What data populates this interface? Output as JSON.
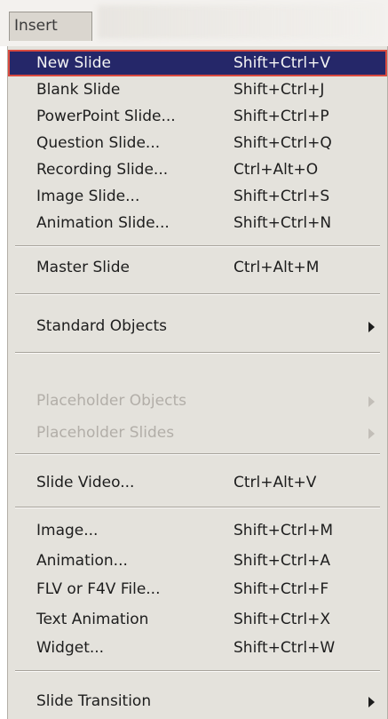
{
  "menubar": {
    "insert_label": "Insert"
  },
  "menu": {
    "items": [
      {
        "label": "New Slide",
        "shortcut": "Shift+Ctrl+V"
      },
      {
        "label": "Blank Slide",
        "shortcut": "Shift+Ctrl+J"
      },
      {
        "label": "PowerPoint Slide...",
        "shortcut": "Shift+Ctrl+P"
      },
      {
        "label": "Question Slide...",
        "shortcut": "Shift+Ctrl+Q"
      },
      {
        "label": "Recording Slide...",
        "shortcut": "Ctrl+Alt+O"
      },
      {
        "label": "Image Slide...",
        "shortcut": "Shift+Ctrl+S"
      },
      {
        "label": "Animation Slide...",
        "shortcut": "Shift+Ctrl+N"
      },
      {
        "label": "Master Slide",
        "shortcut": "Ctrl+Alt+M"
      },
      {
        "label": "Standard Objects",
        "shortcut": ""
      },
      {
        "label": "Placeholder Objects",
        "shortcut": ""
      },
      {
        "label": "Placeholder Slides",
        "shortcut": ""
      },
      {
        "label": "Slide Video...",
        "shortcut": "Ctrl+Alt+V"
      },
      {
        "label": "Image...",
        "shortcut": "Shift+Ctrl+M"
      },
      {
        "label": "Animation...",
        "shortcut": "Shift+Ctrl+A"
      },
      {
        "label": "FLV or F4V File...",
        "shortcut": "Shift+Ctrl+F"
      },
      {
        "label": "Text Animation",
        "shortcut": "Shift+Ctrl+X"
      },
      {
        "label": "Widget...",
        "shortcut": "Shift+Ctrl+W"
      },
      {
        "label": "Slide Transition",
        "shortcut": ""
      }
    ]
  },
  "icons": {
    "submenu": "submenu-arrow-icon"
  },
  "colors": {
    "highlight_bg": "#252769",
    "highlight_border": "#d94a3f",
    "menu_bg": "#e4e2dc",
    "disabled_text": "#b2aea8"
  }
}
